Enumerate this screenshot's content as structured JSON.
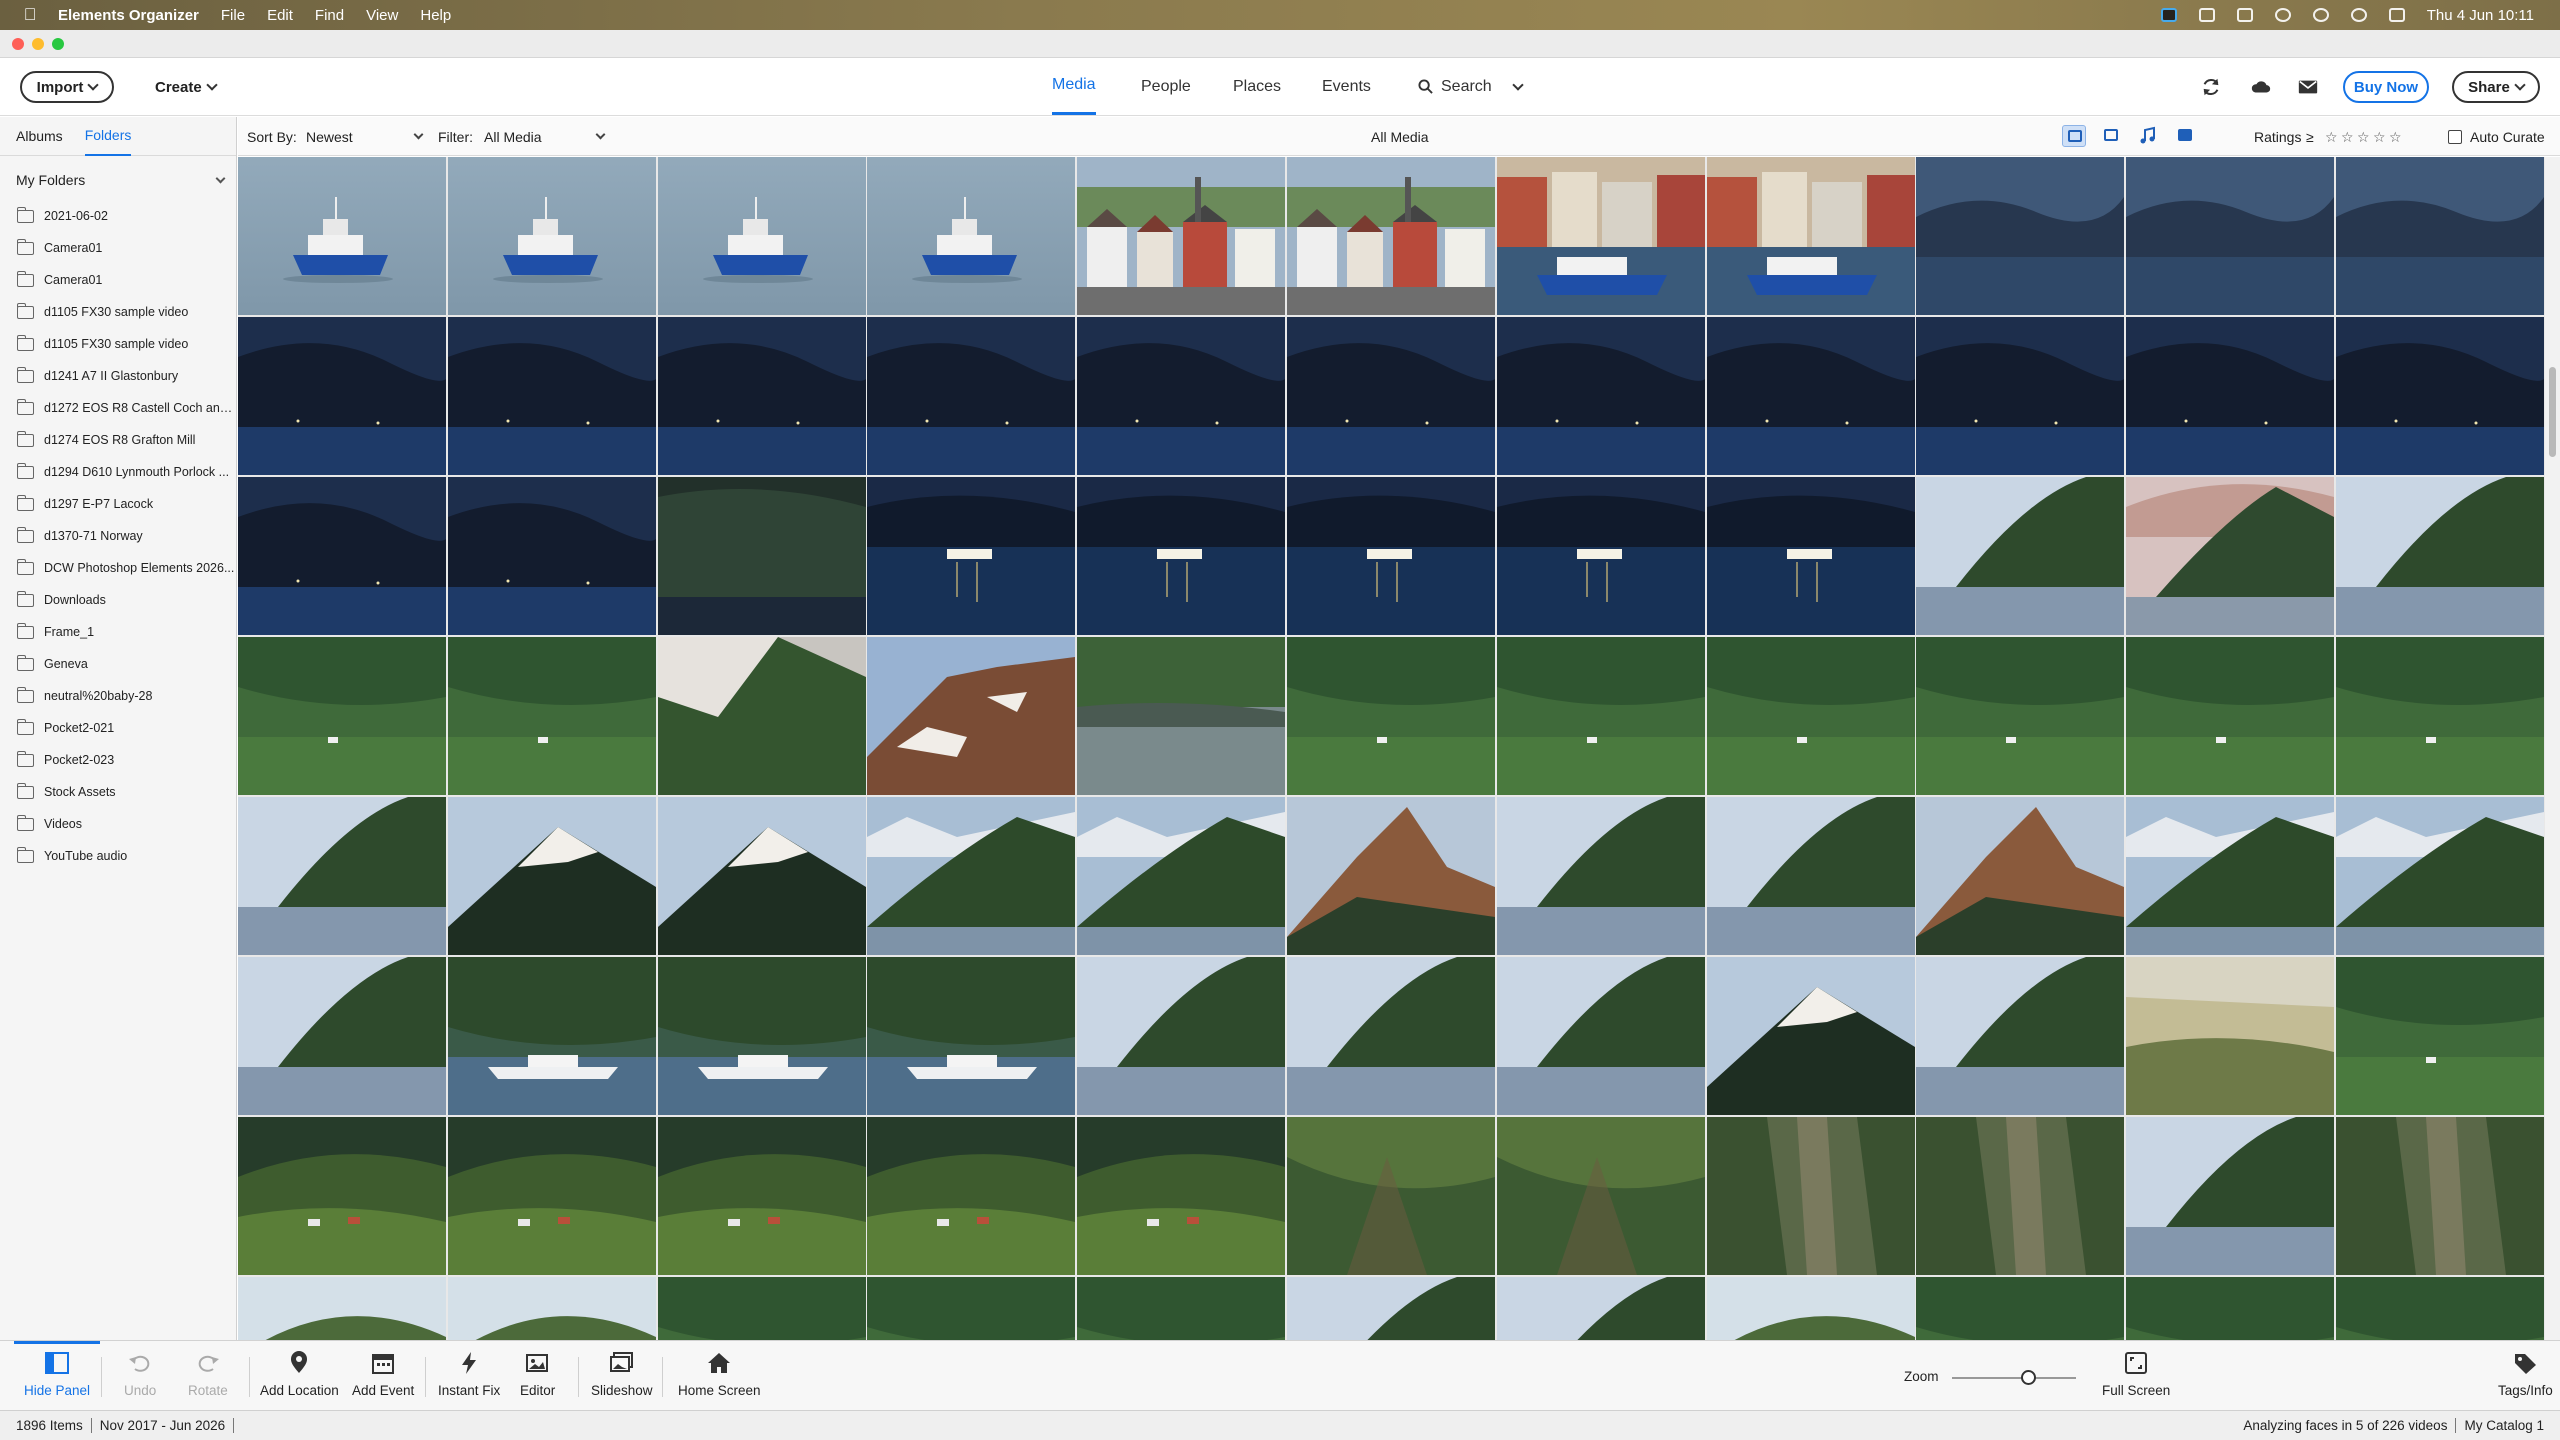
{
  "menubar": {
    "app_name": "Elements Organizer",
    "menus": [
      "File",
      "Edit",
      "Find",
      "View",
      "Help"
    ],
    "clock": "Thu 4 Jun  10:11"
  },
  "toolbar": {
    "import_label": "Import",
    "create_label": "Create",
    "tabs": [
      "Media",
      "People",
      "Places",
      "Events"
    ],
    "active_tab": "Media",
    "search_label": "Search",
    "buy_now_label": "Buy Now",
    "share_label": "Share"
  },
  "panel": {
    "tabs": [
      "Albums",
      "Folders"
    ],
    "active_tab": "Folders",
    "section_title": "My Folders",
    "folders": [
      "2021-06-02",
      "Camera01",
      "Camera01",
      "d1105 FX30 sample video",
      "d1105 FX30 sample video",
      "d1241 A7 II Glastonbury",
      "d1272 EOS R8 Castell Coch and...",
      "d1274 EOS R8 Grafton Mill",
      "d1294 D610 Lynmouth Porlock ...",
      "d1297 E-P7 Lacock",
      "d1370-71 Norway",
      "DCW Photoshop Elements 2026...",
      "Downloads",
      "Frame_1",
      "Geneva",
      "neutral%20baby-28",
      "Pocket2-021",
      "Pocket2-023",
      "Stock Assets",
      "Videos",
      "YouTube audio"
    ]
  },
  "filterbar": {
    "sort_label": "Sort By:",
    "sort_value": "Newest",
    "filter_label": "Filter:",
    "filter_value": "All Media",
    "center_title": "All Media",
    "ratings_label": "Ratings",
    "ratings_op": "≥",
    "auto_curate_label": "Auto Curate"
  },
  "grid": {
    "rows": [
      [
        "boat",
        "boat",
        "boat",
        "boat",
        "town",
        "town",
        "harbor",
        "harbor",
        "fjord-dusk",
        "fjord-dusk",
        "fjord-dusk"
      ],
      [
        "fjord-night",
        "fjord-night",
        "fjord-night",
        "fjord-night",
        "fjord-night",
        "fjord-night",
        "fjord-night",
        "fjord-night",
        "fjord-night",
        "fjord-night",
        "fjord-night"
      ],
      [
        "fjord-night",
        "fjord-night",
        "forest-dark",
        "ferry-night",
        "ferry-night",
        "ferry-night",
        "ferry-night",
        "ferry-night",
        "fjord-day",
        "fjord-pink",
        "fjord-day"
      ],
      [
        "forest",
        "forest",
        "snow-slope",
        "rock-peak",
        "forest-water",
        "forest",
        "forest",
        "forest",
        "forest",
        "forest",
        "forest"
      ],
      [
        "fjord-day",
        "mountain-snow",
        "mountain-snow",
        "mountain-green",
        "mountain-green",
        "peak-sunlit",
        "fjord-day",
        "fjord-day",
        "peak-sunlit",
        "mountain-green",
        "mountain-green"
      ],
      [
        "fjord-day",
        "ferry-day",
        "ferry-day",
        "ferry-day",
        "fjord-day",
        "fjord-day",
        "fjord-day",
        "mountain-snow",
        "fjord-day",
        "valley",
        "forest"
      ],
      [
        "farm",
        "farm",
        "farm",
        "farm",
        "farm",
        "forest-sun",
        "forest-sun",
        "cliff",
        "cliff",
        "fjord-day",
        "cliff"
      ],
      [
        "hill",
        "hill",
        "forest",
        "forest",
        "forest",
        "fjord-day",
        "fjord-day",
        "hill",
        "forest",
        "forest",
        "forest"
      ]
    ]
  },
  "actions": {
    "hide_panel": "Hide Panel",
    "undo": "Undo",
    "rotate": "Rotate",
    "add_location": "Add Location",
    "add_event": "Add Event",
    "instant_fix": "Instant Fix",
    "editor": "Editor",
    "slideshow": "Slideshow",
    "home_screen": "Home Screen",
    "zoom_label": "Zoom",
    "full_screen": "Full Screen",
    "tags_info": "Tags/Info"
  },
  "status": {
    "items": "1896 Items",
    "range": "Nov 2017 - Jun 2026",
    "analyzing": "Analyzing faces in 5 of 226 videos",
    "catalog": "My Catalog 1"
  }
}
